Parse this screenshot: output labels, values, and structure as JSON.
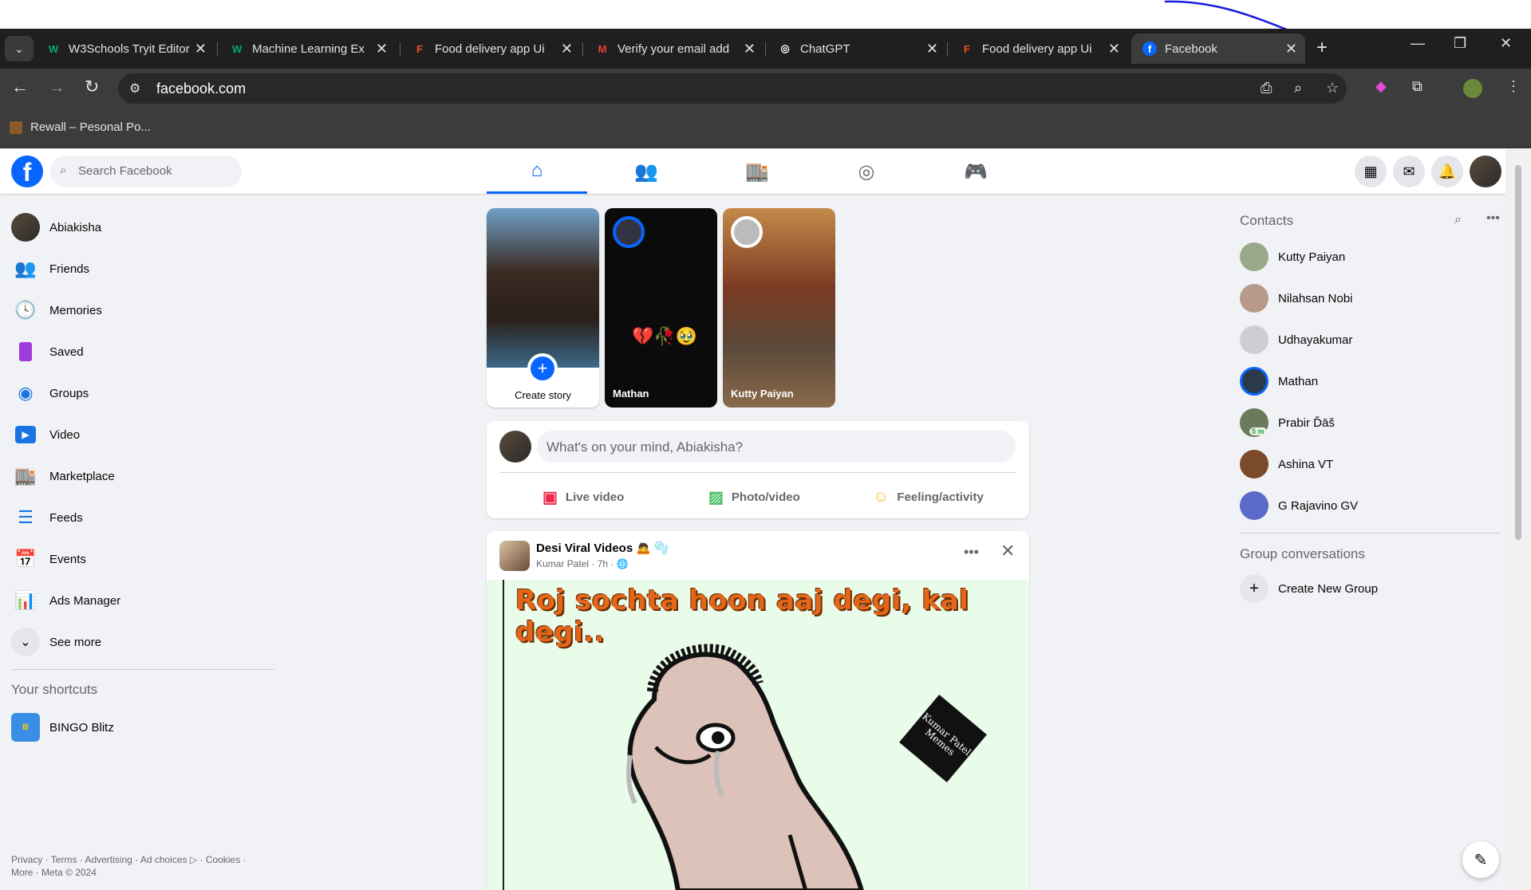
{
  "browser": {
    "tabs": [
      {
        "title": "W3Schools Tryit Editor",
        "fav": "W",
        "fav_color": "#04aa6d"
      },
      {
        "title": "Machine Learning Ex",
        "fav": "W",
        "fav_color": "#04aa6d"
      },
      {
        "title": "Food delivery app Ui",
        "fav": "F",
        "fav_color": "#f24e1e"
      },
      {
        "title": "Verify your email add",
        "fav": "M",
        "fav_color": "#ea4335"
      },
      {
        "title": "ChatGPT",
        "fav": "◎",
        "fav_color": "#ffffff"
      },
      {
        "title": "Food delivery app Ui",
        "fav": "F",
        "fav_color": "#f24e1e"
      },
      {
        "title": "Facebook",
        "fav": "f",
        "fav_color": "#0866ff"
      }
    ],
    "url": "facebook.com",
    "bookmark": "Rewall – Pesonal Po..."
  },
  "fb": {
    "search_placeholder": "Search Facebook",
    "left_menu": [
      {
        "label": "Abiakisha",
        "icon": "avatar"
      },
      {
        "label": "Friends",
        "icon": "friends-icon"
      },
      {
        "label": "Memories",
        "icon": "memories-icon"
      },
      {
        "label": "Saved",
        "icon": "saved-icon"
      },
      {
        "label": "Groups",
        "icon": "groups-icon"
      },
      {
        "label": "Video",
        "icon": "video-icon"
      },
      {
        "label": "Marketplace",
        "icon": "marketplace-icon"
      },
      {
        "label": "Feeds",
        "icon": "feeds-icon"
      },
      {
        "label": "Events",
        "icon": "events-icon"
      },
      {
        "label": "Ads Manager",
        "icon": "ads-manager-icon"
      },
      {
        "label": "See more",
        "icon": "chevron-down-icon"
      }
    ],
    "shortcuts_heading": "Your shortcuts",
    "shortcuts": [
      {
        "label": "BINGO Blitz"
      }
    ],
    "footer": "Privacy · Terms · Advertising · Ad choices ▷ · Cookies · More · Meta © 2024",
    "stories": [
      {
        "label": "Create story"
      },
      {
        "label": "Mathan"
      },
      {
        "label": "Kutty Paiyan"
      }
    ],
    "composer": {
      "placeholder": "What's on your mind, Abiakisha?",
      "actions": [
        "Live video",
        "Photo/video",
        "Feeling/activity"
      ]
    },
    "post": {
      "title": "Desi Viral Videos 🙇 🫧",
      "author": "Kumar Patel",
      "time": "7h",
      "caption": "Roj sochta hoon aaj degi, kal degi..",
      "watermark": "Kumar Patel Memes"
    },
    "contacts_heading": "Contacts",
    "contacts": [
      {
        "name": "Kutty Paiyan"
      },
      {
        "name": "Nilahsan Nobi"
      },
      {
        "name": "Udhayakumar"
      },
      {
        "name": "Mathan"
      },
      {
        "name": "Prabir Ďāš",
        "badge": "5 m"
      },
      {
        "name": "Ashina VT"
      },
      {
        "name": "G Rajavino GV"
      }
    ],
    "group_conv_heading": "Group conversations",
    "create_group": "Create New Group"
  }
}
